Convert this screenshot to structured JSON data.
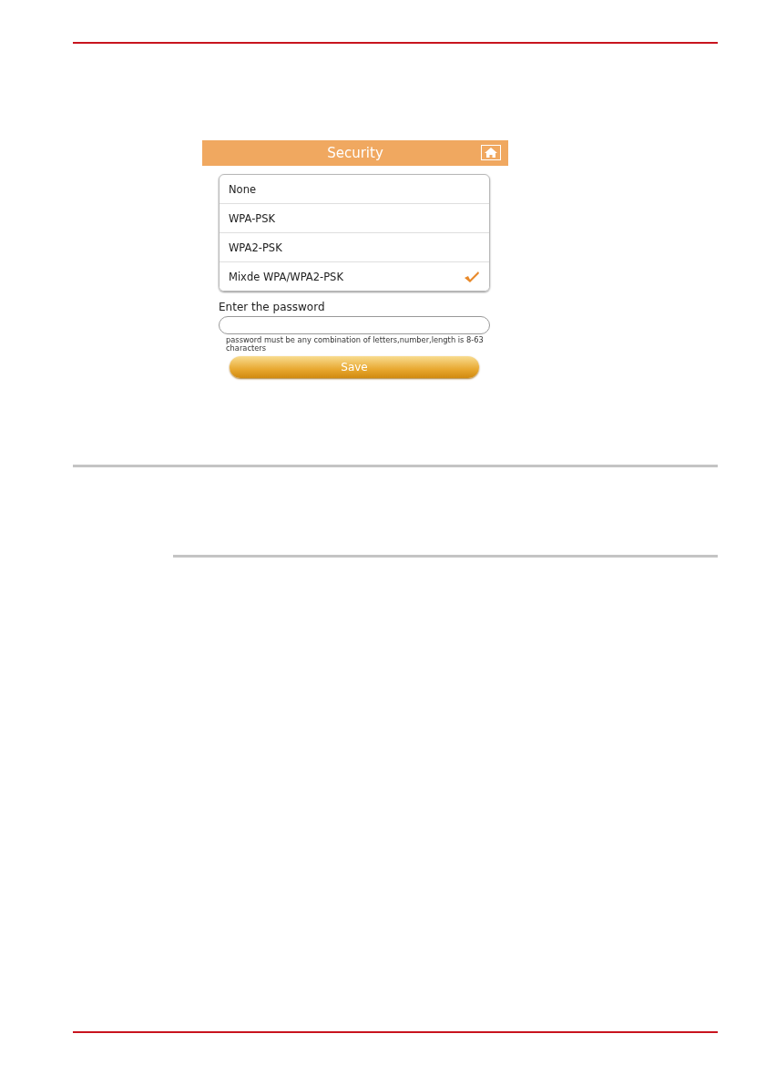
{
  "screen": {
    "title": "Security",
    "options": [
      {
        "label": "None",
        "selected": false
      },
      {
        "label": "WPA-PSK",
        "selected": false
      },
      {
        "label": "WPA2-PSK",
        "selected": false
      },
      {
        "label": "Mixde WPA/WPA2-PSK",
        "selected": true
      }
    ],
    "password_label": "Enter the password",
    "hint": "password must be any combination of letters,number,length is 8-63 characters",
    "save_button": "Save"
  }
}
